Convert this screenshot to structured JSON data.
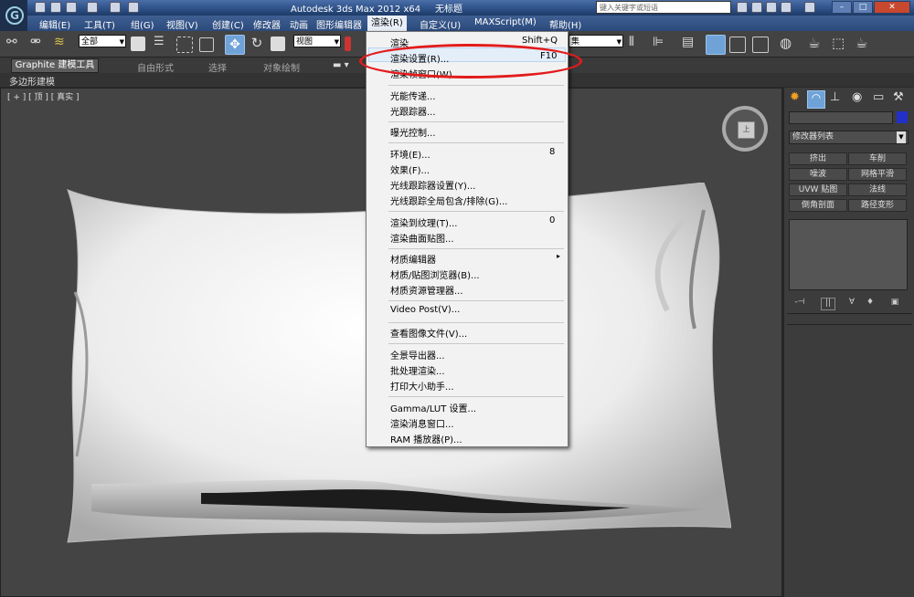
{
  "title_bar": {
    "app_name": "Autodesk 3ds Max  2012 x64",
    "doc_name": "无标题",
    "search_placeholder": "键入关键字或短语"
  },
  "logo_glyph": "G",
  "menu_bar": {
    "items": [
      "编辑(E)",
      "工具(T)",
      "组(G)",
      "视图(V)",
      "创建(C)",
      "修改器",
      "动画",
      "图形编辑器",
      "渲染(R)",
      "自定义(U)",
      "MAXScript(M)",
      "帮助(H)"
    ]
  },
  "toolbar": {
    "selection_filter": "全部",
    "ref_coord": "视图",
    "named_sets": "集"
  },
  "ribbon": {
    "tabs": [
      "Graphite 建模工具",
      "自由形式",
      "选择",
      "对象绘制"
    ],
    "sub_tab": "多边形建模"
  },
  "viewport": {
    "label": "[ + ] [ 顶 ] [ 真实 ]",
    "viewcube_face": "上"
  },
  "render_menu": {
    "items": [
      {
        "label": "渲染",
        "shortcut": "Shift+Q"
      },
      {
        "label": "渲染设置(R)...",
        "shortcut": "F10",
        "highlighted": true
      },
      {
        "label": "渲染帧窗口(W)...",
        "shortcut": ""
      },
      {
        "label": "光能传递...",
        "shortcut": ""
      },
      {
        "label": "光跟踪器...",
        "shortcut": ""
      },
      {
        "label": "曝光控制...",
        "shortcut": ""
      },
      {
        "label": "环境(E)...",
        "shortcut": "8"
      },
      {
        "label": "效果(F)...",
        "shortcut": ""
      },
      {
        "label": "光线跟踪器设置(Y)...",
        "shortcut": ""
      },
      {
        "label": "光线跟踪全局包含/排除(G)...",
        "shortcut": ""
      },
      {
        "label": "渲染到纹理(T)...",
        "shortcut": "0"
      },
      {
        "label": "渲染曲面贴图...",
        "shortcut": ""
      },
      {
        "label": "材质编辑器",
        "shortcut": "▸"
      },
      {
        "label": "材质/贴图浏览器(B)...",
        "shortcut": ""
      },
      {
        "label": "材质资源管理器...",
        "shortcut": ""
      },
      {
        "label": "Video Post(V)...",
        "shortcut": ""
      },
      {
        "label": "查看图像文件(V)...",
        "shortcut": ""
      },
      {
        "label": "全景导出器...",
        "shortcut": ""
      },
      {
        "label": "批处理渲染...",
        "shortcut": ""
      },
      {
        "label": "打印大小助手...",
        "shortcut": ""
      },
      {
        "label": "Gamma/LUT 设置...",
        "shortcut": ""
      },
      {
        "label": "渲染消息窗口...",
        "shortcut": ""
      },
      {
        "label": "RAM 播放器(P)...",
        "shortcut": ""
      }
    ]
  },
  "command_panel": {
    "modifier_list": "修改器列表",
    "buttons": [
      "挤出",
      "车削",
      "噪波",
      "网格平滑",
      "UVW 贴图",
      "法线",
      "倒角剖面",
      "路径变形"
    ],
    "stack_icons": [
      "-⊣",
      "|| ",
      "∀",
      "♦",
      "▣"
    ]
  },
  "colors": {
    "highlight_ring": "#e31b1b",
    "object_color": "#2330c8",
    "menu_highlight": "#e3eef9"
  }
}
